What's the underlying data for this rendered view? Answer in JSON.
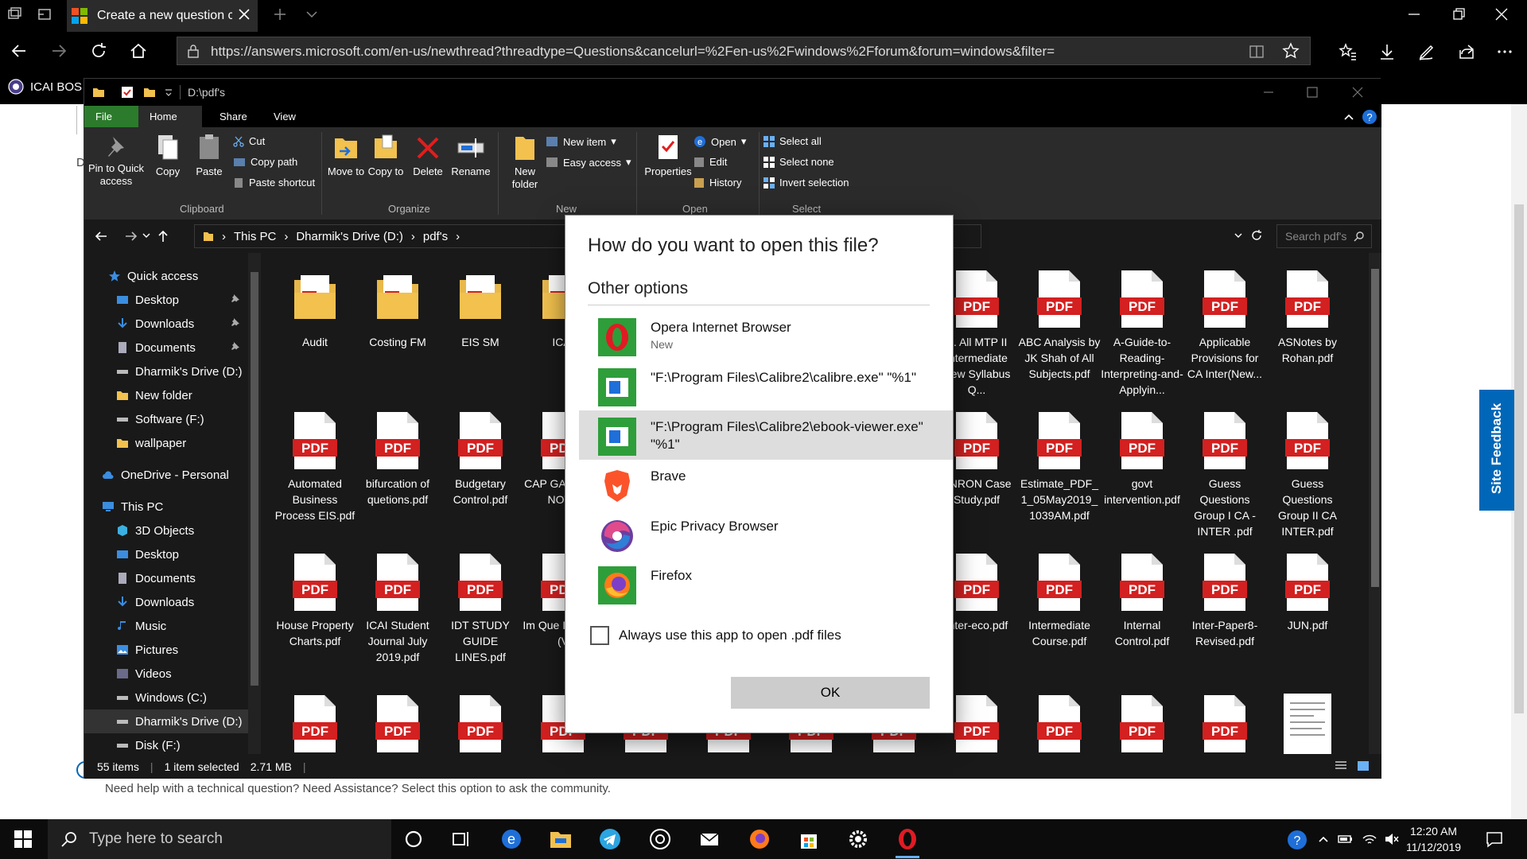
{
  "browser": {
    "tab_title": "Create a new question c",
    "url": "https://answers.microsoft.com/en-us/newthread?threadtype=Questions&cancelurl=%2Fen-us%2Fwindows%2Fforum&forum=windows&filter=",
    "favorite_label": "ICAI BOS"
  },
  "webpage": {
    "fragment_letter": "D",
    "help_text": "Need help with a technical question? Need Assistance? Select this option to ask the community.",
    "site_feedback": "Site Feedback"
  },
  "explorer": {
    "title": "D:\\pdf's",
    "tabs": [
      "File",
      "Home",
      "Share",
      "View"
    ],
    "ribbon": {
      "pin": "Pin to Quick access",
      "copy": "Copy",
      "paste": "Paste",
      "cut": "Cut",
      "copy_path": "Copy path",
      "paste_shortcut": "Paste shortcut",
      "move_to": "Move to",
      "copy_to": "Copy to",
      "delete": "Delete",
      "rename": "Rename",
      "new_folder": "New folder",
      "new_item": "New item",
      "easy_access": "Easy access",
      "properties": "Properties",
      "open": "Open",
      "edit": "Edit",
      "history": "History",
      "select_all": "Select all",
      "select_none": "Select none",
      "invert_selection": "Invert selection",
      "groups": {
        "clipboard": "Clipboard",
        "organize": "Organize",
        "new": "New",
        "open": "Open",
        "select": "Select"
      }
    },
    "breadcrumb": [
      "This PC",
      "Dharmik's Drive (D:)",
      "pdf's"
    ],
    "search_placeholder": "Search pdf's",
    "sidebar": [
      {
        "label": "Quick access",
        "icon": "star-icon"
      },
      {
        "label": "Desktop",
        "icon": "desktop-icon"
      },
      {
        "label": "Downloads",
        "icon": "download-icon"
      },
      {
        "label": "Documents",
        "icon": "documents-icon"
      },
      {
        "label": "Dharmik's Drive (D:)",
        "icon": "drive-icon"
      },
      {
        "label": "New folder",
        "icon": "folder-icon"
      },
      {
        "label": "Software (F:)",
        "icon": "drive-icon"
      },
      {
        "label": "wallpaper",
        "icon": "folder-icon"
      },
      {
        "label": "OneDrive - Personal",
        "icon": "cloud-icon"
      },
      {
        "label": "This PC",
        "icon": "pc-icon"
      },
      {
        "label": "3D Objects",
        "icon": "cube-icon"
      },
      {
        "label": "Desktop",
        "icon": "desktop-icon"
      },
      {
        "label": "Documents",
        "icon": "documents-icon"
      },
      {
        "label": "Downloads",
        "icon": "download-icon"
      },
      {
        "label": "Music",
        "icon": "music-icon"
      },
      {
        "label": "Pictures",
        "icon": "pictures-icon"
      },
      {
        "label": "Videos",
        "icon": "videos-icon"
      },
      {
        "label": "Windows (C:)",
        "icon": "drive-icon"
      },
      {
        "label": "Dharmik's Drive (D:)",
        "icon": "drive-icon"
      },
      {
        "label": "Disk (F:)",
        "icon": "drive-icon"
      }
    ],
    "files": [
      [
        "Audit",
        "Costing FM",
        "EIS SM",
        "ICAI",
        "",
        "",
        "",
        "",
        "A. All MTP II Intermediate New Syllabus Q...",
        "ABC Analysis by JK Shah of All Subjects.pdf",
        "A-Guide-to-Reading-Interpreting-and-Applyin...",
        "Applicable Provisions for CA Inter(New...",
        "ASNotes by Rohan.pdf"
      ],
      [
        "Automated Business Process EIS.pdf",
        "bifurcation of quetions.pdf",
        "Budgetary Control.pdf",
        "CAP GAIN WRI NOTE",
        "",
        "",
        "",
        "",
        "ENRON Case Study.pdf",
        "Estimate_PDF_1_05May2019_1039AM.pdf",
        "govt intervention.pdf",
        "Guess Questions Group I CA - INTER .pdf",
        "Guess Questions Group II CA INTER.pdf"
      ],
      [
        "House Property Charts.pdf",
        "ICAI Student Journal July 2019.pdf",
        "IDT STUDY GUIDE LINES.pdf",
        "Im Que INTE 19 (V",
        "",
        "",
        "",
        "",
        "Inter-eco.pdf",
        "Intermediate Course.pdf",
        "Internal Control.pdf",
        "Inter-Paper8-Revised.pdf",
        "JUN.pdf"
      ]
    ],
    "status": {
      "items": "55 items",
      "selected": "1 item selected",
      "size": "2.71 MB"
    }
  },
  "dialog": {
    "title": "How do you want to open this file?",
    "other_options": "Other options",
    "options": [
      {
        "name": "Opera Internet Browser",
        "sub": "New"
      },
      {
        "name": "\"F:\\Program Files\\Calibre2\\calibre.exe\" \"%1\"",
        "sub": ""
      },
      {
        "name": "\"F:\\Program Files\\Calibre2\\ebook-viewer.exe\" \"%1\"",
        "sub": ""
      },
      {
        "name": "Brave",
        "sub": ""
      },
      {
        "name": "Epic Privacy Browser",
        "sub": ""
      },
      {
        "name": "Firefox",
        "sub": ""
      }
    ],
    "always_label": "Always use this app to open .pdf files",
    "ok": "OK"
  },
  "taskbar": {
    "search_placeholder": "Type here to search",
    "time": "12:20 AM",
    "date": "11/12/2019"
  },
  "colors": {
    "pdf_red": "#d32020",
    "accent_blue": "#0067b8",
    "file_tab_green": "#2c7b2c"
  }
}
